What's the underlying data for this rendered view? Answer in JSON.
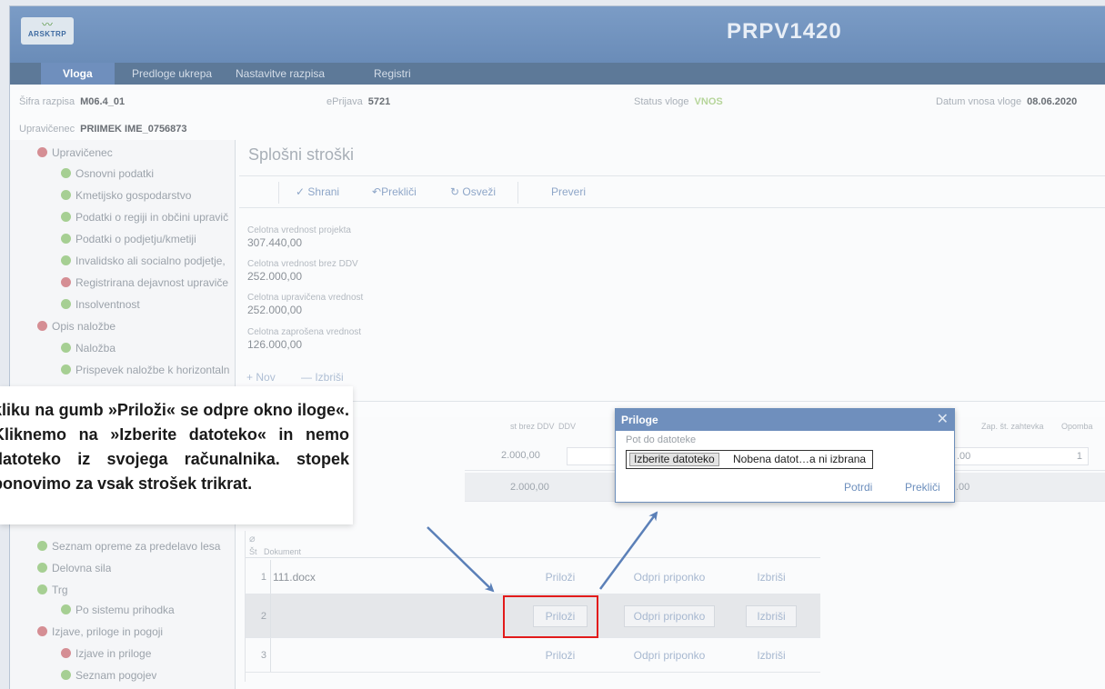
{
  "app": {
    "logo_text": "ARSKTRP",
    "title": "PRPV1420"
  },
  "nav": [
    {
      "label": "Vloga",
      "active": true
    },
    {
      "label": "Predloge ukrepa"
    },
    {
      "label": "Nastavitve razpisa"
    },
    {
      "label": "Registri"
    }
  ],
  "info": {
    "sifra_label": "Šifra razpisa",
    "sifra_value": "M06.4_01",
    "eprijava_label": "ePrijava",
    "eprijava_value": "5721",
    "status_label": "Status vloge",
    "status_value": "VNOS",
    "datum_label": "Datum vnosa vloge",
    "datum_value": "08.06.2020",
    "upravicenec_label": "Upravičenec",
    "upravicenec_value": "PRIIMEK IME_0756873"
  },
  "sidebar": [
    {
      "label": "Upravičenec",
      "status": "red",
      "level": 1
    },
    {
      "label": "Osnovni podatki",
      "status": "green",
      "level": 2
    },
    {
      "label": "Kmetijsko gospodarstvo",
      "status": "green",
      "level": 2
    },
    {
      "label": "Podatki o regiji in občini upravič",
      "status": "green",
      "level": 2
    },
    {
      "label": "Podatki o podjetju/kmetiji",
      "status": "green",
      "level": 2
    },
    {
      "label": "Invalidsko ali socialno podjetje,",
      "status": "green",
      "level": 2
    },
    {
      "label": "Registrirana dejavnost upraviče",
      "status": "red",
      "level": 2
    },
    {
      "label": "Insolventnost",
      "status": "green",
      "level": 2
    },
    {
      "label": "Opis naložbe",
      "status": "red",
      "level": 1
    },
    {
      "label": "Naložba",
      "status": "green",
      "level": 2
    },
    {
      "label": "Prispevek naložbe k horizontaln",
      "status": "green",
      "level": 2
    },
    {
      "label": "Seznam opreme za predelavo lesa",
      "status": "green",
      "level": 1
    },
    {
      "label": "Delovna sila",
      "status": "green",
      "level": 1
    },
    {
      "label": "Trg",
      "status": "green",
      "level": 1
    },
    {
      "label": "Po sistemu prihodka",
      "status": "green",
      "level": 2
    },
    {
      "label": "Izjave, priloge in pogoji",
      "status": "red",
      "level": 1
    },
    {
      "label": "Izjave in priloge",
      "status": "red",
      "level": 2
    },
    {
      "label": "Seznam pogojev",
      "status": "green",
      "level": 2
    }
  ],
  "main": {
    "title": "Splošni stroški",
    "toolbar": {
      "save": "Shrani",
      "cancel": "Prekliči",
      "refresh": "Osveži",
      "check": "Preveri"
    },
    "fields": [
      {
        "label": "Celotna vrednost projekta",
        "value": "307.440,00"
      },
      {
        "label": "Celotna vrednost brez DDV",
        "value": "252.000,00"
      },
      {
        "label": "Celotna upravičena vrednost",
        "value": "252.000,00"
      },
      {
        "label": "Celotna zaprošena vrednost",
        "value": "126.000,00"
      }
    ],
    "add_link": "Nov",
    "delete_link": "Izbriši"
  },
  "grid": {
    "head_brez": "st brez DDV",
    "head_ddv": "DDV",
    "head_zap": "Zap. št. zahtevka",
    "head_opomba": "Opomba",
    "row1_value": "2.000,00",
    "row1_suffix": ".00",
    "row1_zap": "1",
    "row2_value": "2.000,00",
    "row2_suffix": ".00"
  },
  "attachments": {
    "col_st": "Št",
    "col_doc": "Dokument",
    "rows": [
      {
        "num": "1",
        "doc": "111.docx",
        "attach": "Priloži",
        "open": "Odpri priponko",
        "delete": "Izbriši"
      },
      {
        "num": "2",
        "doc": "",
        "attach": "Priloži",
        "open": "Odpri priponko",
        "delete": "Izbriši"
      },
      {
        "num": "3",
        "doc": "",
        "attach": "Priloži",
        "open": "Odpri priponko",
        "delete": "Izbriši"
      }
    ]
  },
  "dialog": {
    "title": "Priloge",
    "path_label": "Pot do datoteke",
    "choose_button": "Izberite datoteko",
    "no_file": "Nobena datot…a ni izbrana",
    "confirm": "Potrdi",
    "cancel": "Prekliči"
  },
  "annotation": {
    "text": "kliku na gumb »Priloži« se odpre okno iloge«. Kliknemo na »Izberite datoteko« in nemo datoteko iz svojega računalnika. stopek ponovimo za vsak strošek trikrat."
  },
  "colors": {
    "accent": "#6f8fbd",
    "status_red": "#d58e94",
    "status_green": "#a6cf93",
    "highlight": "#e21b1b"
  }
}
